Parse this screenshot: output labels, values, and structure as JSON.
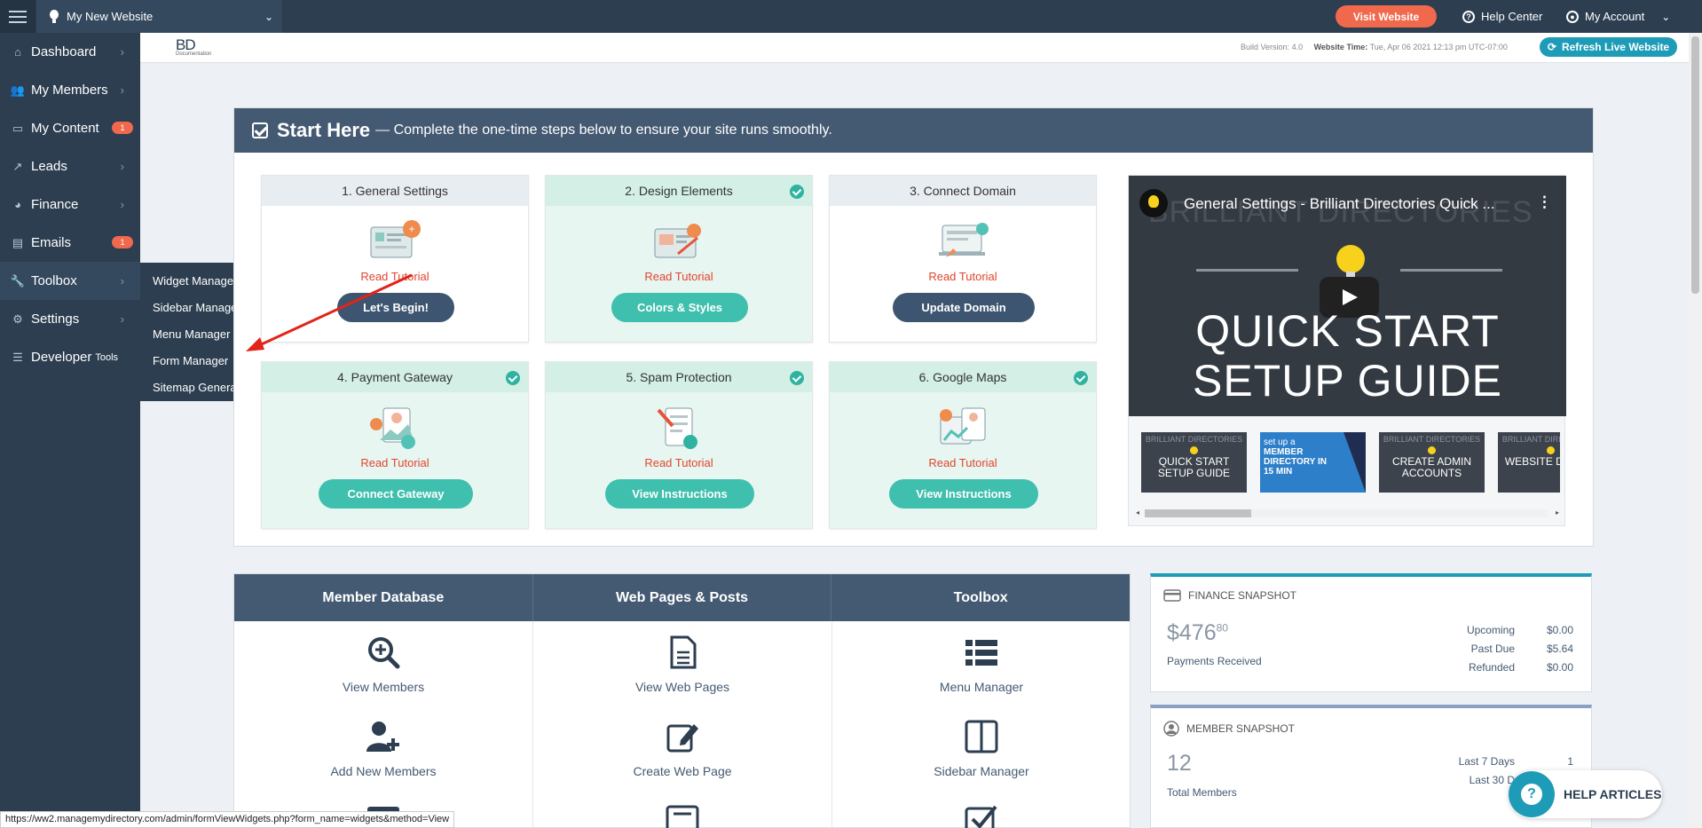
{
  "topbar": {
    "site_name": "My New Website",
    "visit_label": "Visit Website",
    "help_label": "Help Center",
    "account_label": "My Account"
  },
  "sidebar": {
    "items": [
      {
        "label": "Dashboard",
        "icon": "home-icon"
      },
      {
        "label": "My Members",
        "icon": "users-icon"
      },
      {
        "label": "My Content",
        "icon": "folder-icon",
        "badge": "1"
      },
      {
        "label": "Leads",
        "icon": "share-icon"
      },
      {
        "label": "Finance",
        "icon": "pie-chart-icon"
      },
      {
        "label": "Emails",
        "icon": "inbox-icon",
        "badge": "1"
      },
      {
        "label": "Toolbox",
        "icon": "wrench-icon"
      },
      {
        "label": "Settings",
        "icon": "gear-icon"
      },
      {
        "label": "Developer",
        "small": "Tools",
        "icon": "sliders-icon"
      }
    ],
    "flyout": [
      "Widget Manager",
      "Sidebar Manager",
      "Menu Manager",
      "Form Manager",
      "Sitemap Generator"
    ]
  },
  "subheader": {
    "logo_text": "BD",
    "logo_sub": "Documentation",
    "build_label": "Build Version:",
    "build_value": "4.0",
    "time_label": "Website Time:",
    "time_value": "Tue, Apr 06 2021 12:13 pm UTC-07:00",
    "refresh_label": "Refresh Live Website"
  },
  "start": {
    "title": "Start Here",
    "subtitle": "— Complete the one-time steps below to ensure your site runs smoothly.",
    "tutorial_label": "Read Tutorial",
    "steps": [
      {
        "title": "1. General Settings",
        "button": "Let's Begin!",
        "done": false
      },
      {
        "title": "2. Design Elements",
        "button": "Colors & Styles",
        "done": true
      },
      {
        "title": "3. Connect Domain",
        "button": "Update Domain",
        "done": false
      },
      {
        "title": "4. Payment Gateway",
        "button": "Connect Gateway",
        "done": true
      },
      {
        "title": "5. Spam Protection",
        "button": "View Instructions",
        "done": true
      },
      {
        "title": "6. Google Maps",
        "button": "View Instructions",
        "done": true
      }
    ],
    "video": {
      "title": "General Settings - Brilliant Directories Quick ...",
      "bg_text": "BRILLIANT DIRECTORIES",
      "line1": "QUICK START",
      "line2": "SETUP GUIDE",
      "thumbs": [
        {
          "small": "BRILLIANT DIRECTORIES",
          "main": "QUICK START SETUP GUIDE"
        },
        {
          "small": "set up a",
          "main": "MEMBER DIRECTORY IN 15 MIN"
        },
        {
          "small": "BRILLIANT DIRECTORIES",
          "main": "CREATE ADMIN ACCOUNTS"
        },
        {
          "small": "BRILLIANT DIRECTORIES",
          "main": "WEBSITE DESIGN"
        }
      ]
    }
  },
  "tools": {
    "columns": [
      "Member Database",
      "Web Pages & Posts",
      "Toolbox"
    ],
    "rows": [
      [
        "View Members",
        "View Web Pages",
        "Menu Manager"
      ],
      [
        "Add New Members",
        "Create Web Page",
        "Sidebar Manager"
      ]
    ]
  },
  "finance": {
    "title": "Finance Snapshot",
    "amount_main": "$476",
    "amount_cents": "80",
    "caption": "Payments Received",
    "rows": [
      {
        "label": "Upcoming",
        "value": "$0.00"
      },
      {
        "label": "Past Due",
        "value": "$5.64"
      },
      {
        "label": "Refunded",
        "value": "$0.00"
      }
    ]
  },
  "members": {
    "title": "Member Snapshot",
    "count": "12",
    "caption": "Total Members",
    "rows": [
      {
        "label": "Last 7 Days",
        "value": "1"
      },
      {
        "label": "Last 30 D",
        "value": ""
      }
    ]
  },
  "help_articles": "HELP ARTICLES",
  "status_url": "https://ww2.managemydirectory.com/admin/formViewWidgets.php?form_name=widgets&method=View",
  "colors": {
    "accent": "#1e9cb7",
    "orange": "#f0694d",
    "navy": "#2c3e50",
    "teal": "#3fbfad"
  }
}
